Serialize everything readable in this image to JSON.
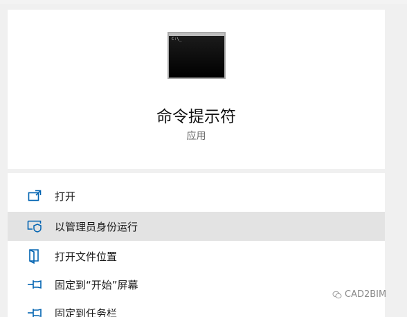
{
  "app": {
    "name": "命令提示符",
    "type": "应用"
  },
  "menu": {
    "items": [
      {
        "label": "打开",
        "icon": "open-window-icon"
      },
      {
        "label": "以管理员身份运行",
        "icon": "shield-run-admin-icon"
      },
      {
        "label": "打开文件位置",
        "icon": "file-location-icon"
      },
      {
        "label": "固定到“开始”屏幕",
        "icon": "pin-icon"
      },
      {
        "label": "固定到任务栏",
        "icon": "pin-icon"
      }
    ]
  },
  "watermark": {
    "text": "CAD2BIM"
  },
  "colors": {
    "accent": "#0063b1",
    "hover": "#e3e3e3"
  }
}
